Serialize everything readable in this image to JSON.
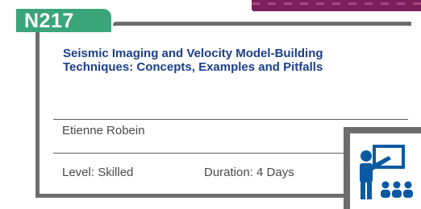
{
  "course": {
    "code": "N217",
    "title_line1": "Seismic Imaging and Velocity Model-Building",
    "title_line2": "Techniques: Concepts, Examples and Pitfalls",
    "instructor": "Etienne Robein",
    "level": "Level: Skilled",
    "duration": "Duration: 4 Days"
  },
  "icons": {
    "class_icon": "teacher-presentation-icon"
  },
  "colors": {
    "code_tab": "#3aa57a",
    "title": "#1b3f8b",
    "frame": "#6d6d6d",
    "icon": "#0a5aa3",
    "top_banner": "#7a1f5c"
  }
}
